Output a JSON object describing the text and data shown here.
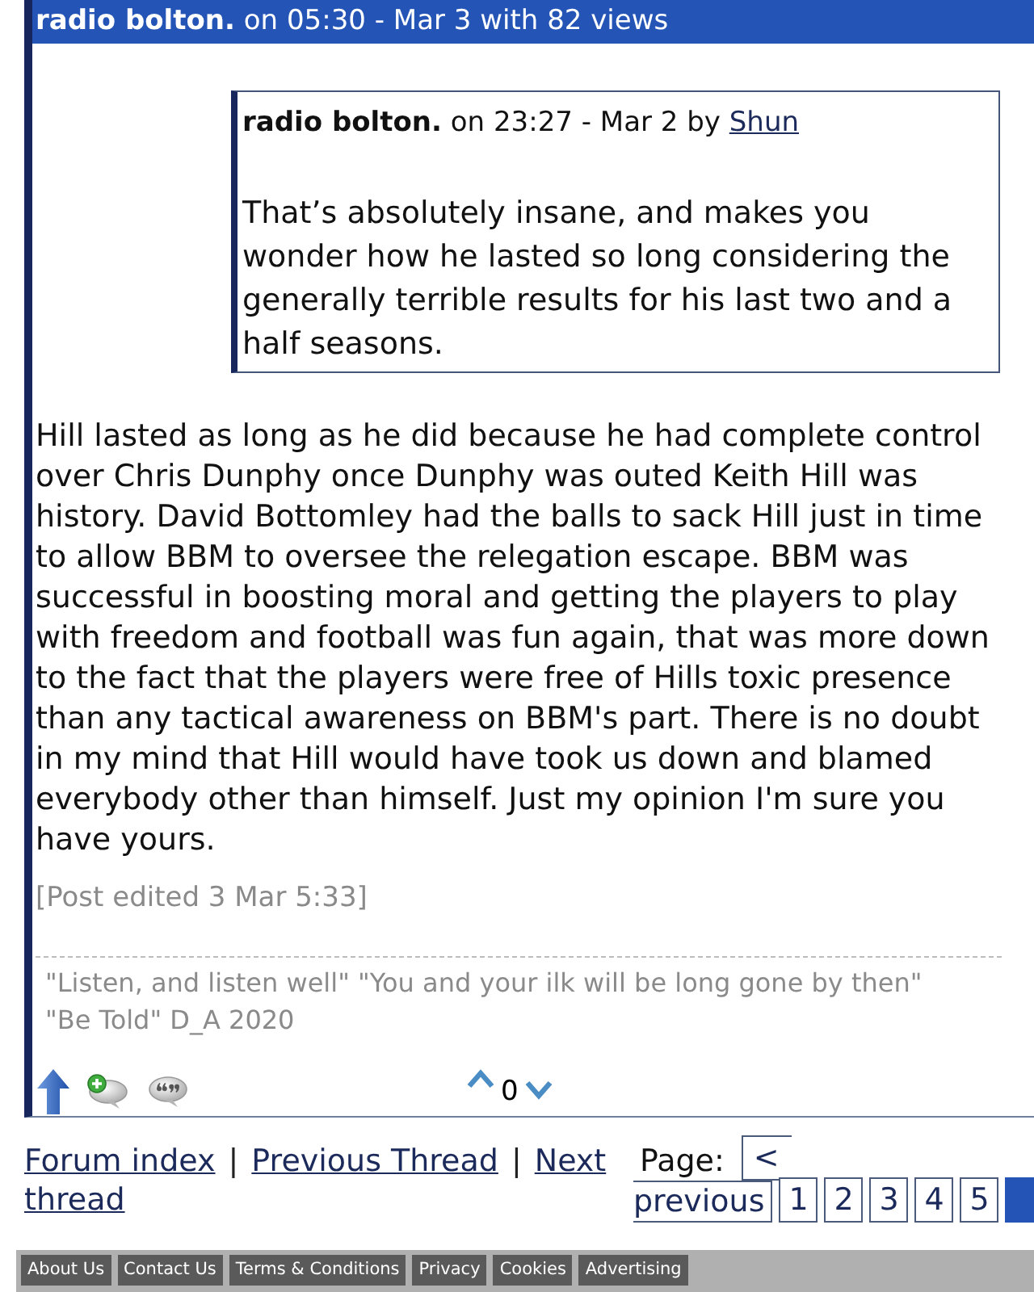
{
  "post": {
    "header": "**radio bolton.** on 05:30 - Mar 3 with 82 views",
    "quote": {
      "title": "**radio bolton.** on 23:27 - Mar 2 by",
      "user": "Shun",
      "text": "That’s absolutely insane, and makes you wonder how he lasted so long considering the generally terrible results for his last two and a half seasons."
    },
    "body": "Hill lasted as long as he did because he had complete control over Chris Dunphy once Dunphy was outed Keith Hill was history. David Bottomley had the balls to sack Hill just in time to allow BBM to oversee the relegation escape. BBM was successful in boosting moral and getting the players to play with freedom and football was fun again, that was more down to the fact that the players were free of Hills toxic presence than any tactical awareness on BBM's part. There is no doubt in my mind that Hill would have took us down and blamed everybody other than himself. Just my opinion I'm sure you have yours.",
    "edited": "[Post edited 3 Mar 5:33]",
    "signature": "\"Listen, and listen well\" \"You and your ilk will be long gone by then\" \"Be Told\" D_A 2020",
    "score": "0"
  },
  "nav": [
    {
      "kind": "link",
      "label": "Forum index"
    },
    {
      "kind": "separator",
      "label": "|"
    },
    {
      "kind": "link",
      "label": "Previous Thread"
    },
    {
      "kind": "separator",
      "label": "|"
    },
    {
      "kind": "link",
      "label": "Next thread"
    }
  ],
  "pagination": {
    "label": "Page:",
    "previous": {
      "arrow": "<",
      "label": "previous"
    },
    "pages": [
      {
        "label": "1",
        "selected": false
      },
      {
        "label": "2",
        "selected": false
      },
      {
        "label": "3",
        "selected": false
      },
      {
        "label": "4",
        "selected": false
      },
      {
        "label": "5",
        "selected": false
      },
      {
        "selected": true
      }
    ]
  },
  "footer": [
    "About Us",
    "Contact Us",
    "Terms & Conditions",
    "Privacy",
    "Cookies",
    "Advertising"
  ]
}
